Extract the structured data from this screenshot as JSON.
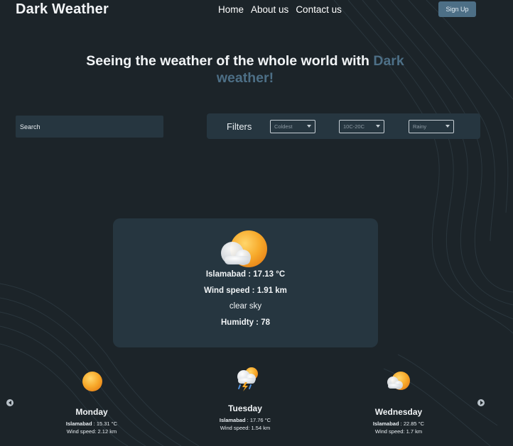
{
  "brand": "Dark Weather",
  "nav": {
    "items": [
      "Home",
      "About us",
      "Contact us"
    ],
    "signup_label": "Sign Up"
  },
  "hero": {
    "main": "Seeing the weather of the whole world with ",
    "accent": "Dark weather!"
  },
  "search": {
    "placeholder": "Search"
  },
  "filters": {
    "label": "Filters",
    "selects": [
      {
        "name": "temperature-order",
        "value": "Coldest"
      },
      {
        "name": "temperature-range",
        "value": "10C-20C"
      },
      {
        "name": "condition",
        "value": "Rainy"
      }
    ]
  },
  "current": {
    "icon": "sun-cloud-icon",
    "location_label": "Islamabad : 17.13 °C",
    "wind_label": "Wind speed : 1.91 km",
    "description": "clear sky",
    "humidity_label": "Humidty : 78"
  },
  "forecast": [
    {
      "day": "Monday",
      "icon": "sun-icon",
      "city": "Islamabad",
      "temp": "15.31 °C",
      "wind": "Wind speed: 2.12 km"
    },
    {
      "day": "Tuesday",
      "icon": "storm-icon",
      "city": "Islamabad",
      "temp": "17.76 °C",
      "wind": "Wind speed: 1.54 km"
    },
    {
      "day": "Wednesday",
      "icon": "sun-cloud-icon",
      "city": "Islamabad",
      "temp": "22.85 °C",
      "wind": "Wind speed: 1.7 km"
    }
  ],
  "colors": {
    "background": "#1c2429",
    "panel": "#263640",
    "accent": "#4d6f86",
    "sun": "#f5a623"
  }
}
